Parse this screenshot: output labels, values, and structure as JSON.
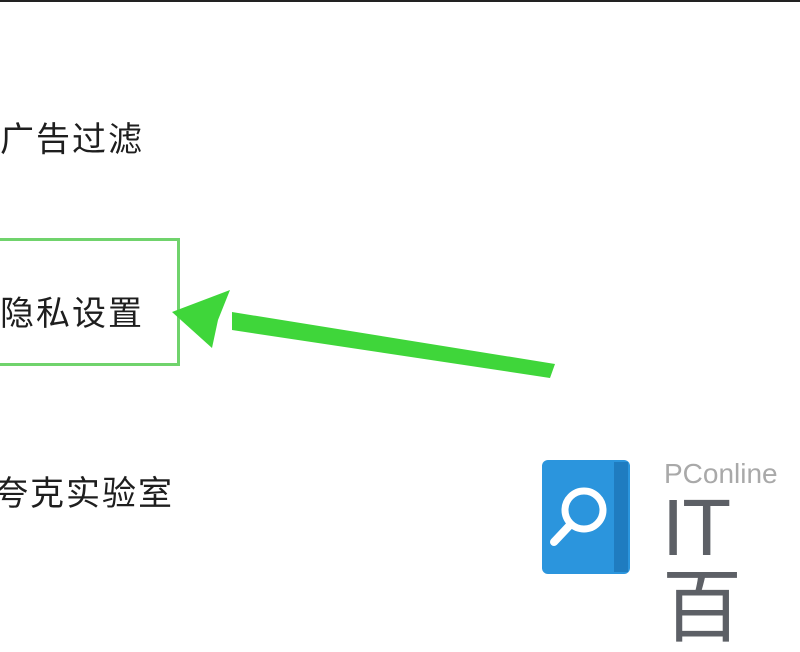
{
  "menu": {
    "items": [
      {
        "label": "广告过滤"
      },
      {
        "label": "隐私设置"
      },
      {
        "label": "夸克实验室"
      }
    ]
  },
  "watermark": {
    "brand_small": "PConline",
    "brand_large": "IT百"
  },
  "colors": {
    "highlight_border": "#70d36c",
    "arrow": "#3fd63a",
    "logo_blue": "#2b95dd"
  },
  "icons": [
    "magnifier-icon",
    "book-icon",
    "arrow-pointer"
  ]
}
